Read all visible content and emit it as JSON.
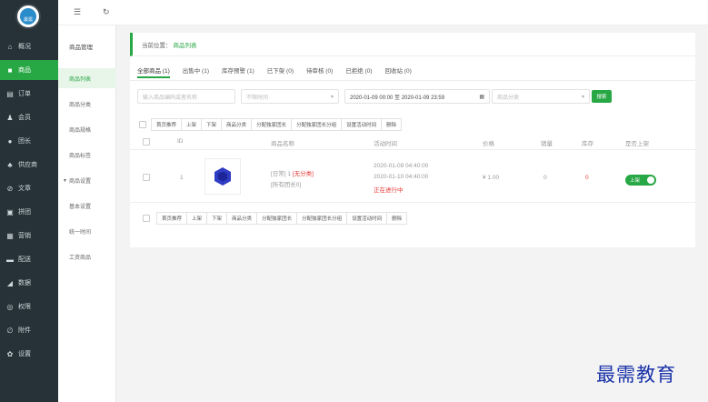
{
  "sidebar": {
    "logo_text": "最需",
    "items": [
      {
        "label": "概况",
        "icon": "home-icon"
      },
      {
        "label": "商品",
        "icon": "grid-icon"
      },
      {
        "label": "订单",
        "icon": "order-icon"
      },
      {
        "label": "会员",
        "icon": "user-icon"
      },
      {
        "label": "团长",
        "icon": "circle-icon"
      },
      {
        "label": "供应商",
        "icon": "supplier-icon"
      },
      {
        "label": "文章",
        "icon": "compass-icon"
      },
      {
        "label": "拼团",
        "icon": "group-icon"
      },
      {
        "label": "营销",
        "icon": "marketing-icon"
      },
      {
        "label": "配送",
        "icon": "truck-icon"
      },
      {
        "label": "数据",
        "icon": "chart-icon"
      },
      {
        "label": "权限",
        "icon": "lock-icon"
      },
      {
        "label": "附件",
        "icon": "attach-icon"
      },
      {
        "label": "设置",
        "icon": "gear-icon"
      }
    ],
    "active_index": 1
  },
  "subnav": {
    "header": "商品管理",
    "items": [
      "商品列表",
      "商品分类",
      "商品规格",
      "商品标签"
    ],
    "group": "商品设置",
    "group_items": [
      "基本设置",
      "统一时间",
      "工资商品"
    ]
  },
  "topbar": {
    "menu_icon": "menu-icon",
    "refresh_icon": "refresh-icon"
  },
  "breadcrumb": {
    "prefix": "当前位置：",
    "current": "商品列表"
  },
  "tabs": [
    "全部商品 (1)",
    "出售中 (1)",
    "库存预警 (1)",
    "已下架 (0)",
    "待审核 (0)",
    "已拒绝 (0)",
    "回收站 (0)"
  ],
  "filters": {
    "keyword_placeholder": "输入商品编码或者名称",
    "time_placeholder": "不限时间",
    "date_range": "2020-01-09 00:00 至 2020-01-09 23:59",
    "category_placeholder": "商品分类",
    "search_label": "搜索"
  },
  "actions": [
    "首页推荐",
    "上架",
    "下架",
    "商品分类",
    "分配独家团长",
    "分配独家团长分组",
    "设置活动时间",
    "删除"
  ],
  "columns": [
    "ID",
    "商品名称",
    "活动时间",
    "价格",
    "销量",
    "库存",
    "是否上架"
  ],
  "rows": [
    {
      "id": "1",
      "name_prefix": "[日常] 1 ",
      "name_tag": "[无分类]",
      "name_sub": "[所有团长0]",
      "time_start": "2020-01-09 04:40:00",
      "time_end": "2020-01-10 04:40:00",
      "status": "正在进行中",
      "price": "¥ 1.00",
      "sales": "0",
      "stock": "0",
      "toggle_label": "上架",
      "toggle_on": true
    }
  ],
  "watermark": "最需教育",
  "colors": {
    "accent": "#28a745",
    "sidebar": "#263238",
    "danger": "#e53935"
  }
}
